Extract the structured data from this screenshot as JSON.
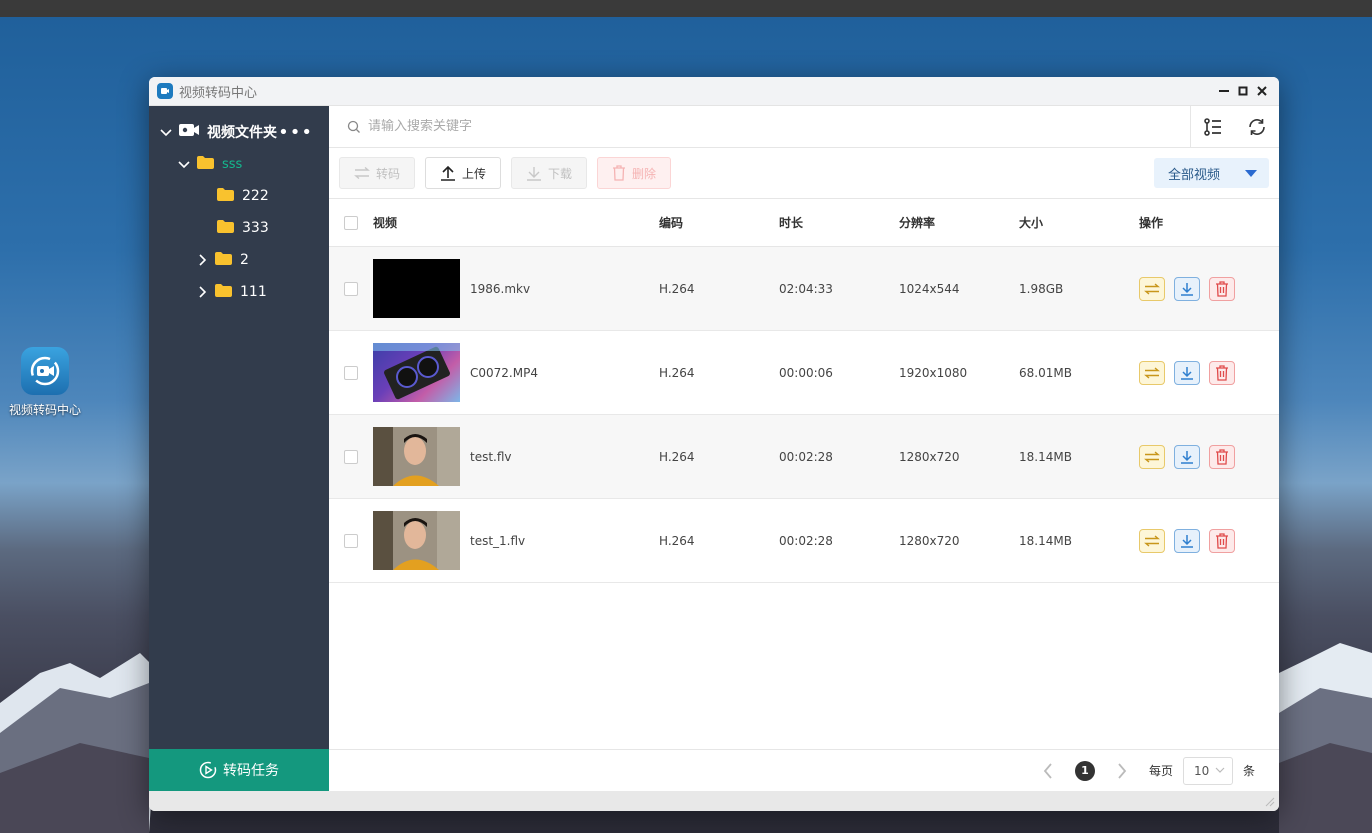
{
  "desktop": {
    "icon_label": "视频转码中心"
  },
  "window": {
    "title": "视频转码中心",
    "controls": {
      "minimize": "–",
      "maximize": "□",
      "close": "×"
    }
  },
  "sidebar": {
    "root_label": "视频文件夹",
    "more": "•••",
    "folders": [
      {
        "label": "sss",
        "expanded": true,
        "level": 1
      },
      {
        "label": "222",
        "level": 2
      },
      {
        "label": "333",
        "level": 2
      },
      {
        "label": "2",
        "level": 1,
        "collapsed": true
      },
      {
        "label": "111",
        "level": 1,
        "collapsed": true
      }
    ],
    "task_button": "转码任务"
  },
  "search": {
    "placeholder": "请输入搜索关键字"
  },
  "toolbar": {
    "transcode": "转码",
    "upload": "上传",
    "download": "下载",
    "delete": "删除",
    "filter": "全部视频"
  },
  "table": {
    "headers": {
      "video": "视频",
      "encoding": "编码",
      "duration": "时长",
      "resolution": "分辨率",
      "size": "大小",
      "actions": "操作"
    },
    "rows": [
      {
        "name": "1986.mkv",
        "encoding": "H.264",
        "duration": "02:04:33",
        "resolution": "1024x544",
        "size": "1.98GB",
        "thumb": "black"
      },
      {
        "name": "C0072.MP4",
        "encoding": "H.264",
        "duration": "00:00:06",
        "resolution": "1920x1080",
        "size": "68.01MB",
        "thumb": "gpu"
      },
      {
        "name": "test.flv",
        "encoding": "H.264",
        "duration": "00:02:28",
        "resolution": "1280x720",
        "size": "18.14MB",
        "thumb": "face"
      },
      {
        "name": "test_1.flv",
        "encoding": "H.264",
        "duration": "00:02:28",
        "resolution": "1280x720",
        "size": "18.14MB",
        "thumb": "face"
      }
    ]
  },
  "pagination": {
    "current": "1",
    "per_page_label": "每页",
    "per_page": "10",
    "unit": "条"
  },
  "colors": {
    "sidebar": "#323c4c",
    "accent_green": "#14987e",
    "folder": "#f9c22e",
    "sss_text": "#14b88e"
  }
}
